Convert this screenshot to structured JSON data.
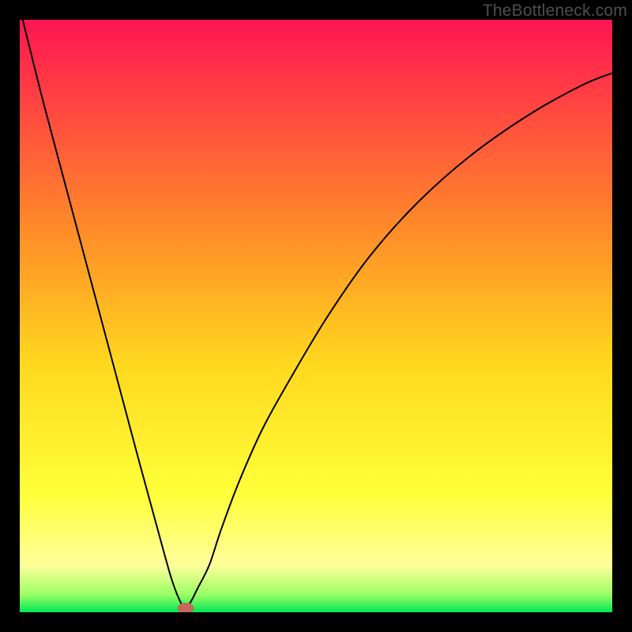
{
  "watermark": "TheBottleneck.com",
  "chart_data": {
    "type": "line",
    "title": "",
    "xlabel": "",
    "ylabel": "",
    "xlim": [
      0,
      100
    ],
    "ylim": [
      0,
      100
    ],
    "legend": false,
    "annotations": [],
    "background_gradient": [
      {
        "y": 100,
        "color": "#ff1552"
      },
      {
        "y": 65,
        "color": "#ff8a29"
      },
      {
        "y": 42,
        "color": "#ffd81f"
      },
      {
        "y": 20,
        "color": "#ffff3a"
      },
      {
        "y": 8,
        "color": "#ffff9b"
      },
      {
        "y": 3,
        "color": "#9bff66"
      },
      {
        "y": 0,
        "color": "#00e756"
      }
    ],
    "series": [
      {
        "name": "bottleneck-curve",
        "color": "#000000",
        "width": 2,
        "x": [
          0.5,
          4,
          8,
          12,
          16,
          20,
          23,
          25.5,
          27,
          28,
          29,
          30,
          32,
          34,
          37,
          41,
          46,
          52,
          59,
          67,
          76,
          86,
          95,
          100
        ],
        "y": [
          100,
          86,
          71,
          56,
          41,
          26,
          15,
          6,
          2,
          0.7,
          2,
          4,
          8,
          14,
          22,
          31,
          40,
          50,
          60,
          69,
          77,
          84,
          89,
          91
        ]
      }
    ],
    "marker": {
      "name": "optimal-point",
      "shape": "ellipse",
      "cx": 28,
      "cy": 0.7,
      "rx": 1.4,
      "ry": 0.9,
      "color": "#c46a5a"
    }
  }
}
